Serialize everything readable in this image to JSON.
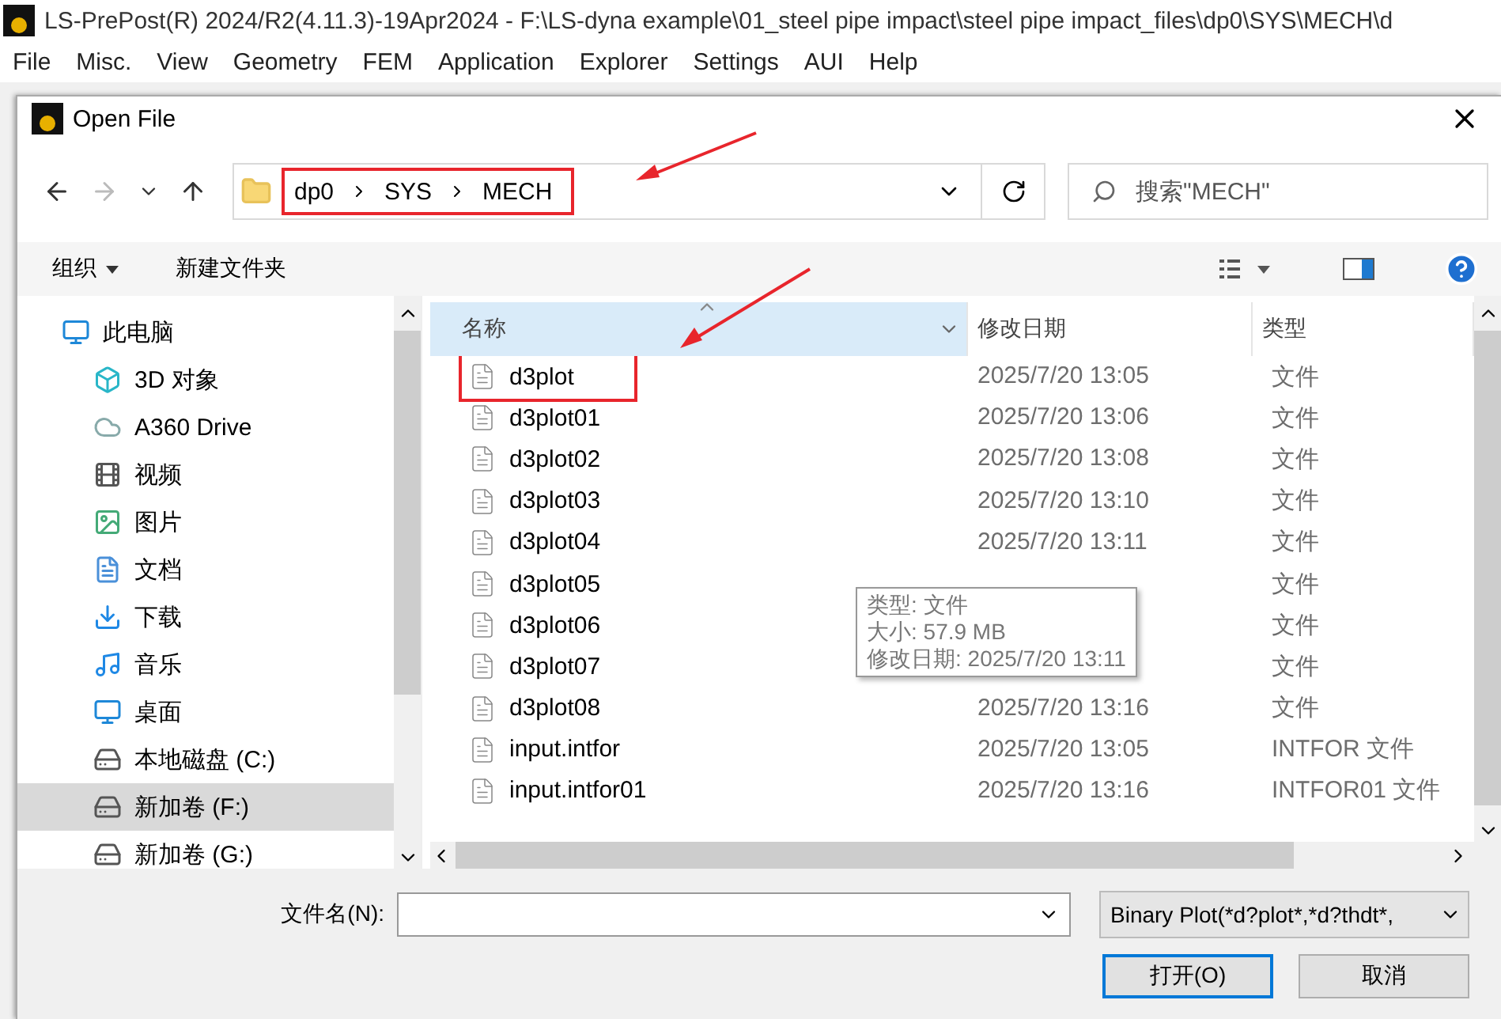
{
  "app": {
    "title": "LS-PrePost(R) 2024/R2(4.11.3)-19Apr2024 - F:\\LS-dyna example\\01_steel pipe impact\\steel pipe impact_files\\dp0\\SYS\\MECH\\d",
    "menu": [
      "File",
      "Misc.",
      "View",
      "Geometry",
      "FEM",
      "Application",
      "Explorer",
      "Settings",
      "AUI",
      "Help"
    ]
  },
  "dialog": {
    "title": "Open File",
    "breadcrumb": {
      "crumbs": [
        "dp0",
        "SYS",
        "MECH"
      ],
      "highlighted": true
    },
    "search": {
      "placeholder": "搜索\"MECH\""
    },
    "toolbar": {
      "organize": "组织",
      "new_folder": "新建文件夹"
    },
    "nav_tree": [
      {
        "label": "此电脑",
        "kind": "pc",
        "selected": false,
        "children": [
          {
            "label": "3D 对象",
            "kind": "cube",
            "selected": false
          },
          {
            "label": "A360 Drive",
            "kind": "cloud",
            "selected": false
          },
          {
            "label": "视频",
            "kind": "video",
            "selected": false
          },
          {
            "label": "图片",
            "kind": "image",
            "selected": false
          },
          {
            "label": "文档",
            "kind": "doc",
            "selected": false
          },
          {
            "label": "下载",
            "kind": "download",
            "selected": false
          },
          {
            "label": "音乐",
            "kind": "music",
            "selected": false
          },
          {
            "label": "桌面",
            "kind": "desktop",
            "selected": false
          },
          {
            "label": "本地磁盘 (C:)",
            "kind": "sysdrive",
            "selected": false
          },
          {
            "label": "新加卷 (F:)",
            "kind": "drive",
            "selected": true
          },
          {
            "label": "新加卷 (G:)",
            "kind": "drive",
            "selected": false
          }
        ]
      }
    ],
    "columns": [
      "名称",
      "修改日期",
      "类型"
    ],
    "files": [
      {
        "name": "d3plot",
        "date": "2025/7/20 13:05",
        "type": "文件",
        "highlighted": true
      },
      {
        "name": "d3plot01",
        "date": "2025/7/20 13:06",
        "type": "文件",
        "highlighted": false
      },
      {
        "name": "d3plot02",
        "date": "2025/7/20 13:08",
        "type": "文件",
        "highlighted": false
      },
      {
        "name": "d3plot03",
        "date": "2025/7/20 13:10",
        "type": "文件",
        "highlighted": false
      },
      {
        "name": "d3plot04",
        "date": "2025/7/20 13:11",
        "type": "文件",
        "highlighted": false
      },
      {
        "name": "d3plot05",
        "type": "文件",
        "highlighted": false
      },
      {
        "name": "d3plot06",
        "type": "文件",
        "highlighted": false
      },
      {
        "name": "d3plot07",
        "type": "文件",
        "highlighted": false
      },
      {
        "name": "d3plot08",
        "date": "2025/7/20 13:16",
        "type": "文件",
        "highlighted": false
      },
      {
        "name": "input.intfor",
        "date": "2025/7/20 13:05",
        "type": "INTFOR 文件",
        "highlighted": false
      },
      {
        "name": "input.intfor01",
        "date": "2025/7/20 13:16",
        "type": "INTFOR01 文件",
        "highlighted": false
      }
    ],
    "tooltip": [
      "类型: 文件",
      "大小: 57.9 MB",
      "修改日期: 2025/7/20 13:11"
    ],
    "filename": {
      "label": "文件名(N):"
    },
    "filter": "Binary Plot(*d?plot*,*d?thdt*,",
    "buttons": [
      {
        "label": "打开(O)",
        "default": true
      },
      {
        "label": "取消",
        "default": false
      }
    ]
  }
}
